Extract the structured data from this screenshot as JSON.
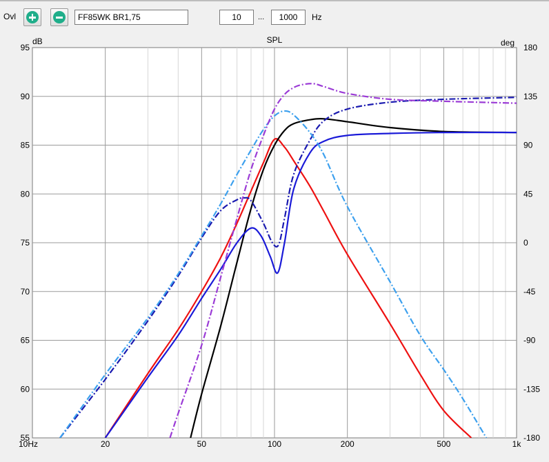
{
  "toolbar": {
    "label": "Ovl",
    "preset_value": "FF85WK BR1,75",
    "freq_min": "10",
    "freq_sep": "...",
    "freq_max": "1000",
    "freq_unit": "Hz"
  },
  "chart_data": {
    "type": "line",
    "title": "SPL",
    "ylabel": "dB",
    "y2label": "deg",
    "xscale": "log",
    "xlim": [
      10,
      1000
    ],
    "ylim": [
      55,
      95
    ],
    "y2lim": [
      -180,
      180
    ],
    "grid": true,
    "x_ticks": [
      {
        "v": 10,
        "label": "10Hz"
      },
      {
        "v": 20,
        "label": "20"
      },
      {
        "v": 50,
        "label": "50"
      },
      {
        "v": 100,
        "label": "100"
      },
      {
        "v": 200,
        "label": "200"
      },
      {
        "v": 500,
        "label": "500"
      },
      {
        "v": 1000,
        "label": "1k"
      }
    ],
    "y_ticks": [
      "55",
      "60",
      "65",
      "70",
      "75",
      "80",
      "85",
      "90",
      "95"
    ],
    "y2_ticks": [
      "-180",
      "-135",
      "-90",
      "-45",
      "0",
      "45",
      "90",
      "135",
      "180"
    ],
    "series": [
      {
        "color": "#ee1111",
        "style": "solid",
        "axis": "left",
        "x": [
          20,
          30,
          40,
          50,
          60,
          70,
          80,
          90,
          100,
          110,
          120,
          140,
          160,
          200,
          300,
          400,
          500,
          650
        ],
        "y": [
          55,
          61.6,
          66.1,
          70.0,
          73.5,
          77.0,
          80.3,
          83.2,
          85.6,
          84.8,
          83.4,
          80.8,
          78.2,
          73.8,
          66.7,
          61.5,
          57.8,
          55
        ]
      },
      {
        "color": "#000000",
        "style": "solid",
        "axis": "left",
        "x": [
          45,
          50,
          60,
          70,
          80,
          90,
          100,
          110,
          120,
          140,
          160,
          200,
          300,
          500,
          1000
        ],
        "y": [
          55,
          59.5,
          66.5,
          73,
          78.5,
          82.5,
          85,
          86.5,
          87.2,
          87.6,
          87.7,
          87.4,
          86.8,
          86.4,
          86.3
        ]
      },
      {
        "color": "#1a1ad8",
        "style": "solid",
        "axis": "left",
        "x": [
          20,
          30,
          40,
          50,
          60,
          70,
          80,
          88,
          96,
          103,
          110,
          120,
          140,
          160,
          200,
          300,
          500,
          1000
        ],
        "y": [
          55,
          61.2,
          65.5,
          69.3,
          72.3,
          75,
          76.5,
          75.7,
          73.6,
          71.9,
          75,
          80.5,
          84.2,
          85.4,
          86,
          86.2,
          86.3,
          86.3
        ]
      },
      {
        "color": "#1a1ab0",
        "style": "dashdot",
        "axis": "left",
        "x": [
          13,
          20,
          30,
          40,
          50,
          60,
          70,
          75,
          80,
          90,
          98,
          104,
          110,
          120,
          140,
          160,
          200,
          300,
          500,
          1000
        ],
        "y": [
          55,
          61,
          67,
          71.6,
          75.5,
          78.3,
          79.4,
          79.6,
          79.3,
          77,
          75,
          74.8,
          77.5,
          82,
          85.5,
          87.5,
          88.7,
          89.4,
          89.7,
          89.9
        ]
      },
      {
        "color": "#3ca0ee",
        "style": "dashdot",
        "axis": "left",
        "x": [
          13,
          20,
          30,
          40,
          50,
          60,
          70,
          80,
          90,
          100,
          110,
          120,
          140,
          160,
          200,
          300,
          400,
          500,
          600,
          750
        ],
        "y": [
          55,
          61.5,
          67.3,
          71.8,
          75.7,
          79,
          82,
          84.5,
          86.6,
          88,
          88.5,
          88.1,
          86.3,
          84,
          78.7,
          71,
          65.5,
          62,
          59,
          55
        ]
      },
      {
        "color": "#9b3bd6",
        "style": "dashdot",
        "axis": "left",
        "x": [
          37,
          40,
          50,
          60,
          70,
          80,
          90,
          100,
          110,
          120,
          130,
          145,
          160,
          200,
          300,
          500,
          1000
        ],
        "y": [
          55,
          57.5,
          64.5,
          71.5,
          77.5,
          82.5,
          86,
          88.7,
          90.2,
          90.9,
          91.2,
          91.3,
          91.0,
          90.3,
          89.7,
          89.5,
          89.3
        ]
      }
    ]
  }
}
